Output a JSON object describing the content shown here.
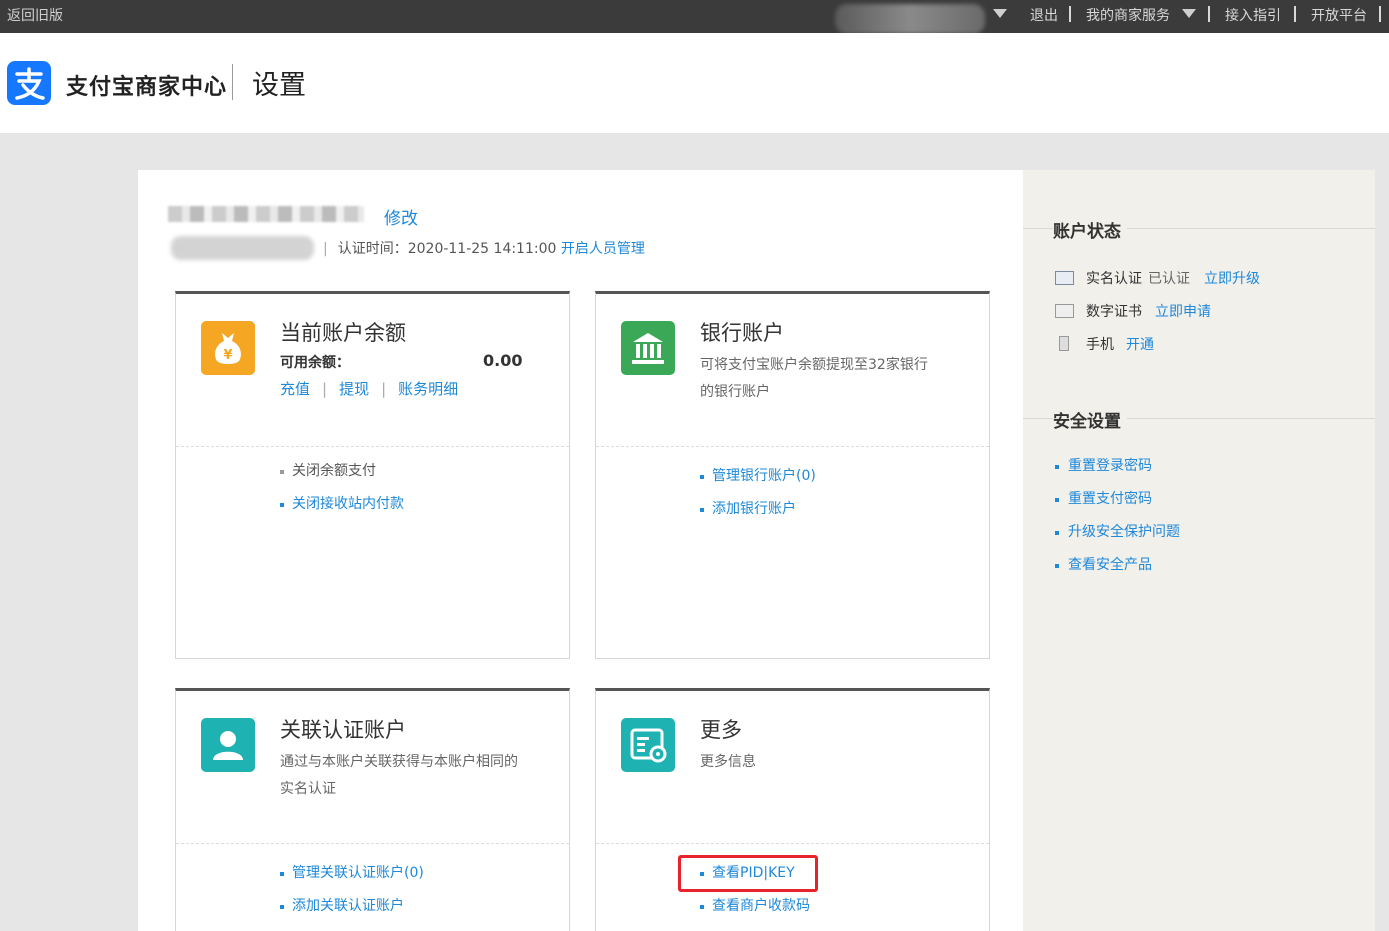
{
  "topbar": {
    "old_version": "返回旧版",
    "logout": "退出",
    "merchant_service": "我的商家服务",
    "guide": "接入指引",
    "open_platform": "开放平台"
  },
  "header": {
    "brand": "支付宝商家中心",
    "page_title": "设置"
  },
  "account": {
    "edit_label": "修改",
    "cert_time_label": "认证时间：",
    "cert_time": "2020-11-25 14:11:00",
    "staff_mgmt": "开启人员管理"
  },
  "cards": {
    "balance": {
      "title": "当前账户余额",
      "available_label": "可用余额：",
      "available_value": "0.00",
      "links": [
        "充值",
        "提现",
        "账务明细"
      ],
      "items": [
        "关闭余额支付",
        "关闭接收站内付款"
      ]
    },
    "bank": {
      "title": "银行账户",
      "desc": "可将支付宝账户余额提现至32家银行的银行账户",
      "items": [
        "管理银行账户(0)",
        "添加银行账户"
      ]
    },
    "linked": {
      "title": "关联认证账户",
      "desc": "通过与本账户关联获得与本账户相同的实名认证",
      "items": [
        "管理关联认证账户(0)",
        "添加关联认证账户"
      ]
    },
    "more": {
      "title": "更多",
      "desc": "更多信息",
      "items": [
        "查看PID|KEY",
        "查看商户收款码"
      ]
    }
  },
  "sidebar": {
    "status_title": "账户状态",
    "status_rows": [
      {
        "label": "实名认证",
        "status": "已认证",
        "action": "立即升级"
      },
      {
        "label": "数字证书",
        "status": "",
        "action": "立即申请"
      },
      {
        "label": "手机",
        "status": "",
        "action": "开通"
      }
    ],
    "security_title": "安全设置",
    "security_items": [
      "重置登录密码",
      "重置支付密码",
      "升级安全保护问题",
      "查看安全产品"
    ]
  },
  "colors": {
    "link": "#1e88d9",
    "highlight": "#e8232b",
    "balance_icon": "#f5a623",
    "bank_icon": "#3aa856",
    "teal_icon": "#1fb2b2"
  }
}
